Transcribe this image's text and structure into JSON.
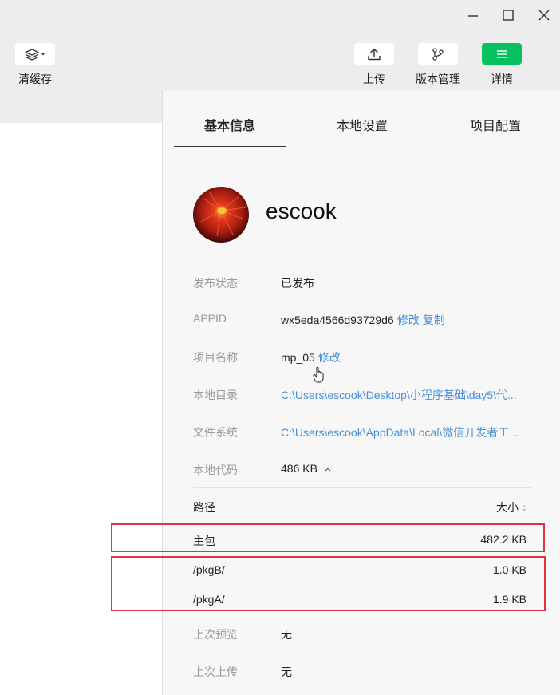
{
  "window": {
    "minimize_icon": "minimize-icon",
    "maximize_icon": "maximize-icon",
    "close_icon": "close-icon"
  },
  "toolbar": {
    "clear_cache": {
      "label": "清缓存",
      "icon": "layers-icon"
    },
    "upload": {
      "label": "上传",
      "icon": "upload-icon"
    },
    "version": {
      "label": "版本管理",
      "icon": "branch-icon"
    },
    "details": {
      "label": "详情",
      "icon": "menu-icon"
    }
  },
  "panel": {
    "tabs": [
      {
        "label": "基本信息",
        "active": true
      },
      {
        "label": "本地设置",
        "active": false
      },
      {
        "label": "项目配置",
        "active": false
      }
    ],
    "profile": {
      "name": "escook"
    },
    "info": {
      "publish_status": {
        "label": "发布状态",
        "value": "已发布"
      },
      "appid": {
        "label": "APPID",
        "value": "wx5eda4566d93729d6",
        "edit": "修改",
        "copy": "复制"
      },
      "project_name": {
        "label": "项目名称",
        "value": "mp_05",
        "edit": "修改"
      },
      "local_dir": {
        "label": "本地目录",
        "value": "C:\\Users\\escook\\Desktop\\小程序基础\\day5\\代..."
      },
      "file_system": {
        "label": "文件系统",
        "value": "C:\\Users\\escook\\AppData\\Local\\微信开发者工..."
      },
      "local_code": {
        "label": "本地代码",
        "value": "486 KB"
      }
    },
    "size_table": {
      "header_path": "路径",
      "header_size": "大小",
      "rows": [
        {
          "path": "主包",
          "size": "482.2 KB"
        },
        {
          "path": "/pkgB/",
          "size": "1.0 KB"
        },
        {
          "path": "/pkgA/",
          "size": "1.9 KB"
        }
      ]
    },
    "last_preview": {
      "label": "上次预览",
      "value": "无"
    },
    "last_upload": {
      "label": "上次上传",
      "value": "无"
    }
  },
  "colors": {
    "accent_green": "#07c160",
    "link_blue": "#4a90d9",
    "highlight_red": "#e0333a"
  }
}
